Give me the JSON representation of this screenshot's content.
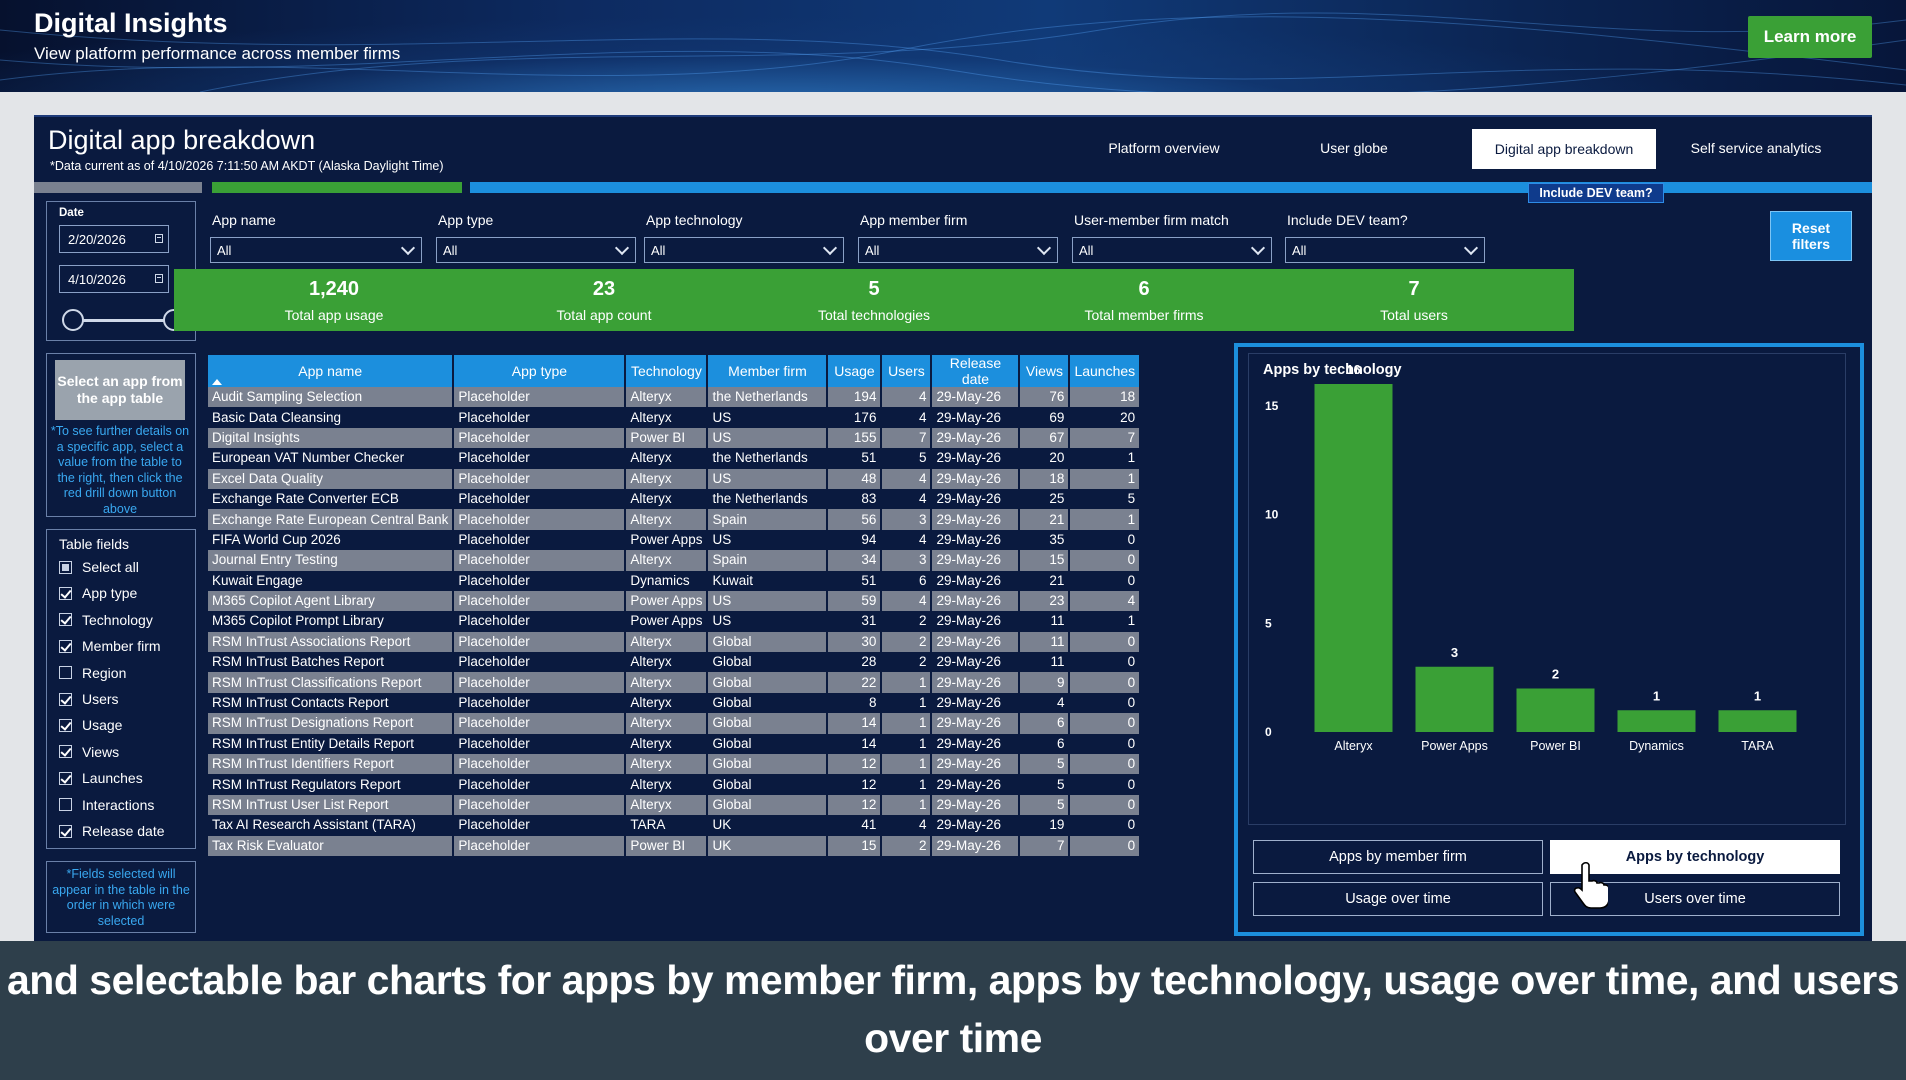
{
  "banner": {
    "title": "Digital Insights",
    "subtitle": "View platform performance across member firms",
    "learn_more": "Learn more"
  },
  "page": {
    "title": "Digital app breakdown",
    "note": "*Data current as of 4/10/2026 7:11:50 AM AKDT (Alaska Daylight Time)"
  },
  "nav": {
    "tabs": [
      "Platform overview",
      "User globe",
      "Digital app breakdown",
      "Self service analytics"
    ],
    "active": "Digital app breakdown"
  },
  "dev_label": "Include DEV team?",
  "date": {
    "label": "Date",
    "start": "2/20/2026",
    "end": "4/10/2026"
  },
  "select_app": {
    "button": "Select an app from the app table",
    "hint": "*To see further details on a specific app, select a value from the table to the right, then click the red drill down button above"
  },
  "table_fields": {
    "title": "Table fields",
    "items": [
      {
        "label": "Select all",
        "state": "partial"
      },
      {
        "label": "App type",
        "state": "on"
      },
      {
        "label": "Technology",
        "state": "on"
      },
      {
        "label": "Member firm",
        "state": "on"
      },
      {
        "label": "Region",
        "state": "off"
      },
      {
        "label": "Users",
        "state": "on"
      },
      {
        "label": "Usage",
        "state": "on"
      },
      {
        "label": "Views",
        "state": "on"
      },
      {
        "label": "Launches",
        "state": "on"
      },
      {
        "label": "Interactions",
        "state": "off"
      },
      {
        "label": "Release date",
        "state": "on"
      }
    ],
    "note": "*Fields selected will appear in the table in the order in which were selected"
  },
  "filters": [
    {
      "label": "App name",
      "value": "All"
    },
    {
      "label": "App type",
      "value": "All"
    },
    {
      "label": "App technology",
      "value": "All"
    },
    {
      "label": "App member firm",
      "value": "All"
    },
    {
      "label": "User-member firm match",
      "value": "All"
    },
    {
      "label": "Include DEV team?",
      "value": "All"
    }
  ],
  "reset_filters": "Reset filters",
  "kpis": [
    {
      "value": "1,240",
      "label": "Total app usage"
    },
    {
      "value": "23",
      "label": "Total app count"
    },
    {
      "value": "5",
      "label": "Total technologies"
    },
    {
      "value": "6",
      "label": "Total member firms"
    },
    {
      "value": "7",
      "label": "Total users"
    }
  ],
  "table": {
    "columns": [
      "App name",
      "App type",
      "Technology",
      "Member firm",
      "Usage",
      "Users",
      "Release date",
      "Views",
      "Launches"
    ],
    "rows": [
      [
        "Audit Sampling Selection",
        "Placeholder",
        "Alteryx",
        "the Netherlands",
        "194",
        "4",
        "29-May-26",
        "76",
        "18"
      ],
      [
        "Basic Data Cleansing",
        "Placeholder",
        "Alteryx",
        "US",
        "176",
        "4",
        "29-May-26",
        "69",
        "20"
      ],
      [
        "Digital Insights",
        "Placeholder",
        "Power BI",
        "US",
        "155",
        "7",
        "29-May-26",
        "67",
        "7"
      ],
      [
        "European VAT Number Checker",
        "Placeholder",
        "Alteryx",
        "the Netherlands",
        "51",
        "5",
        "29-May-26",
        "20",
        "1"
      ],
      [
        "Excel Data Quality",
        "Placeholder",
        "Alteryx",
        "US",
        "48",
        "4",
        "29-May-26",
        "18",
        "1"
      ],
      [
        "Exchange Rate Converter ECB",
        "Placeholder",
        "Alteryx",
        "the Netherlands",
        "83",
        "4",
        "29-May-26",
        "25",
        "5"
      ],
      [
        "Exchange Rate European Central Bank",
        "Placeholder",
        "Alteryx",
        "Spain",
        "56",
        "3",
        "29-May-26",
        "21",
        "1"
      ],
      [
        "FIFA World Cup 2026",
        "Placeholder",
        "Power Apps",
        "US",
        "94",
        "4",
        "29-May-26",
        "35",
        "0"
      ],
      [
        "Journal Entry Testing",
        "Placeholder",
        "Alteryx",
        "Spain",
        "34",
        "3",
        "29-May-26",
        "15",
        "0"
      ],
      [
        "Kuwait Engage",
        "Placeholder",
        "Dynamics",
        "Kuwait",
        "51",
        "6",
        "29-May-26",
        "21",
        "0"
      ],
      [
        "M365 Copilot Agent Library",
        "Placeholder",
        "Power Apps",
        "US",
        "59",
        "4",
        "29-May-26",
        "23",
        "4"
      ],
      [
        "M365 Copilot Prompt Library",
        "Placeholder",
        "Power Apps",
        "US",
        "31",
        "2",
        "29-May-26",
        "11",
        "1"
      ],
      [
        "RSM InTrust Associations Report",
        "Placeholder",
        "Alteryx",
        "Global",
        "30",
        "2",
        "29-May-26",
        "11",
        "0"
      ],
      [
        "RSM InTrust Batches Report",
        "Placeholder",
        "Alteryx",
        "Global",
        "28",
        "2",
        "29-May-26",
        "11",
        "0"
      ],
      [
        "RSM InTrust Classifications Report",
        "Placeholder",
        "Alteryx",
        "Global",
        "22",
        "1",
        "29-May-26",
        "9",
        "0"
      ],
      [
        "RSM InTrust Contacts Report",
        "Placeholder",
        "Alteryx",
        "Global",
        "8",
        "1",
        "29-May-26",
        "4",
        "0"
      ],
      [
        "RSM InTrust Designations Report",
        "Placeholder",
        "Alteryx",
        "Global",
        "14",
        "1",
        "29-May-26",
        "6",
        "0"
      ],
      [
        "RSM InTrust Entity Details Report",
        "Placeholder",
        "Alteryx",
        "Global",
        "14",
        "1",
        "29-May-26",
        "6",
        "0"
      ],
      [
        "RSM InTrust Identifiers Report",
        "Placeholder",
        "Alteryx",
        "Global",
        "12",
        "1",
        "29-May-26",
        "5",
        "0"
      ],
      [
        "RSM InTrust Regulators Report",
        "Placeholder",
        "Alteryx",
        "Global",
        "12",
        "1",
        "29-May-26",
        "5",
        "0"
      ],
      [
        "RSM InTrust User List Report",
        "Placeholder",
        "Alteryx",
        "Global",
        "12",
        "1",
        "29-May-26",
        "5",
        "0"
      ],
      [
        "Tax AI Research Assistant (TARA)",
        "Placeholder",
        "TARA",
        "UK",
        "41",
        "4",
        "29-May-26",
        "19",
        "0"
      ],
      [
        "Tax Risk Evaluator",
        "Placeholder",
        "Power BI",
        "UK",
        "15",
        "2",
        "29-May-26",
        "7",
        "0"
      ]
    ]
  },
  "chart_data": {
    "type": "bar",
    "title": "Apps by technology",
    "categories": [
      "Alteryx",
      "Power Apps",
      "Power BI",
      "Dynamics",
      "TARA"
    ],
    "values": [
      16,
      3,
      2,
      1,
      1
    ],
    "ylim": [
      0,
      16
    ],
    "yticks": [
      "0",
      "5",
      "10",
      "15"
    ],
    "bar_color": "#3aa036",
    "grid": false
  },
  "chart_toggles": [
    "Apps by member firm",
    "Apps by technology",
    "Usage over time",
    "Users over time"
  ],
  "chart_toggle_active": "Apps by technology",
  "caption": "and selectable bar charts for apps by member firm, apps by technology, usage over time, and users over time",
  "colors": {
    "panel_bg": "#0a1a3f",
    "accent_blue": "#1c8fdd",
    "kpi_green": "#3aa036"
  }
}
